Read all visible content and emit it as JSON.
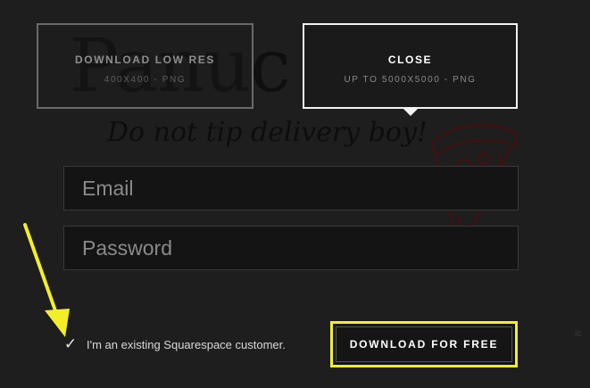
{
  "background": {
    "title": "Panuc zza",
    "subtitle": "Do not tip delivery boy!",
    "edge_text": "ic"
  },
  "options": {
    "low_res": {
      "label": "DOWNLOAD LOW RES",
      "sub": "400X400 - PNG"
    },
    "close": {
      "label": "CLOSE",
      "sub": "UP TO 5000X5000 - PNG"
    }
  },
  "form": {
    "email_placeholder": "Email",
    "password_placeholder": "Password",
    "existing_customer_label": "I'm an existing Squarespace customer.",
    "existing_customer_checked": true,
    "check_glyph": "✓",
    "download_button_label": "DOWNLOAD FOR FREE"
  },
  "colors": {
    "background": "#1e1e1e",
    "highlight": "#f2ef2a",
    "pizza_stroke": "#3a1414"
  },
  "icons": {
    "check": "check-icon",
    "annotation": "arrow-annotation-icon",
    "pizza": "pizza-slice-icon"
  }
}
